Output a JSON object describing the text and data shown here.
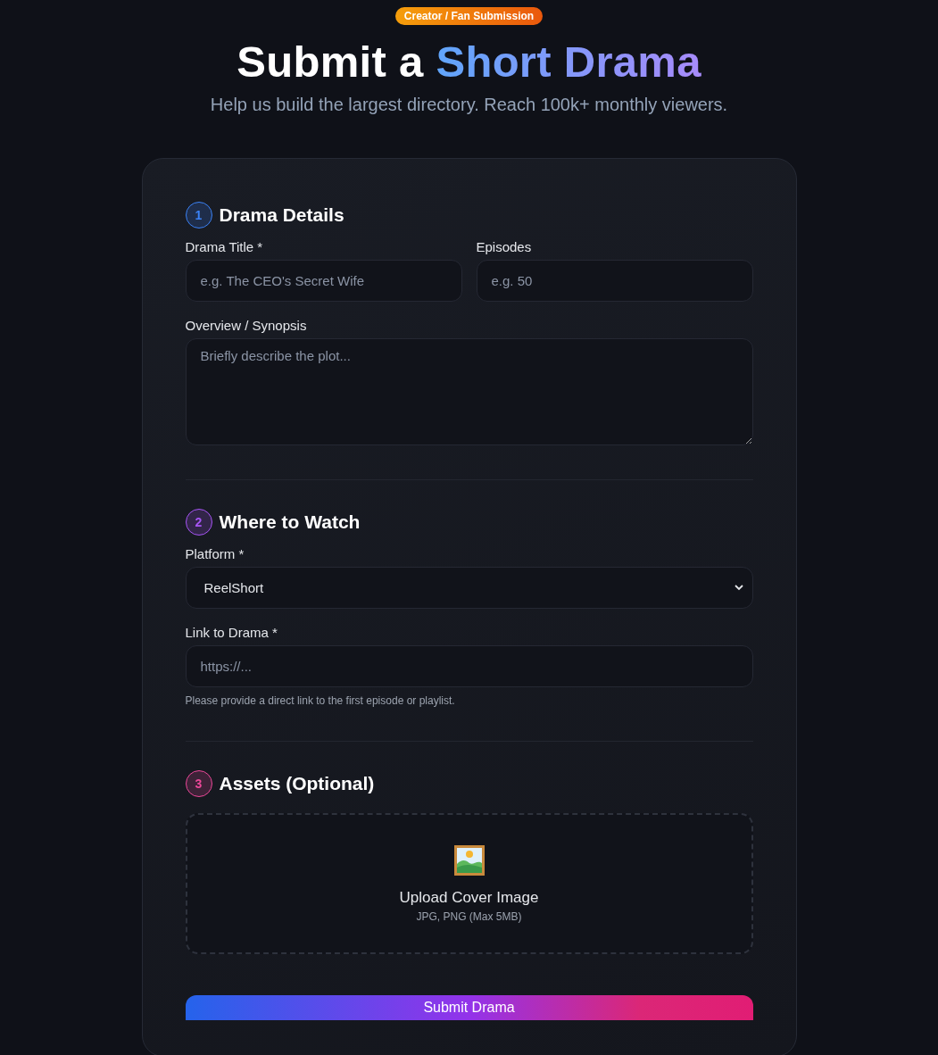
{
  "badge": "Creator / Fan Submission",
  "title": {
    "text": "Submit a",
    "highlight": "Short Drama"
  },
  "subtitle": "Help us build the largest directory. Reach 100k+ monthly viewers.",
  "sections": [
    {
      "number": "1",
      "title": "Drama Details",
      "color": "#3b82f6",
      "rows": [
        [
          {
            "kind": "text",
            "label": "Drama Title *",
            "placeholder": "e.g. The CEO's Secret Wife"
          },
          {
            "kind": "text",
            "label": "Episodes",
            "placeholder": "e.g. 50"
          }
        ],
        [
          {
            "kind": "textarea",
            "label": "Overview / Synopsis",
            "placeholder": "Briefly describe the plot..."
          }
        ]
      ]
    },
    {
      "number": "2",
      "title": "Where to Watch",
      "color": "#a855f7",
      "rows": [
        [
          {
            "kind": "select",
            "label": "Platform *",
            "value": "ReelShort"
          }
        ],
        [
          {
            "kind": "text",
            "label": "Link to Drama *",
            "placeholder": "https://...",
            "hint": "Please provide a direct link to the first episode or playlist."
          }
        ]
      ]
    },
    {
      "number": "3",
      "title": "Assets (Optional)",
      "color": "#ec4899",
      "rows": [
        [
          {
            "kind": "upload",
            "title": "Upload Cover Image",
            "note": "JPG, PNG (Max 5MB)"
          }
        ]
      ]
    }
  ],
  "submit": "Submit Drama"
}
